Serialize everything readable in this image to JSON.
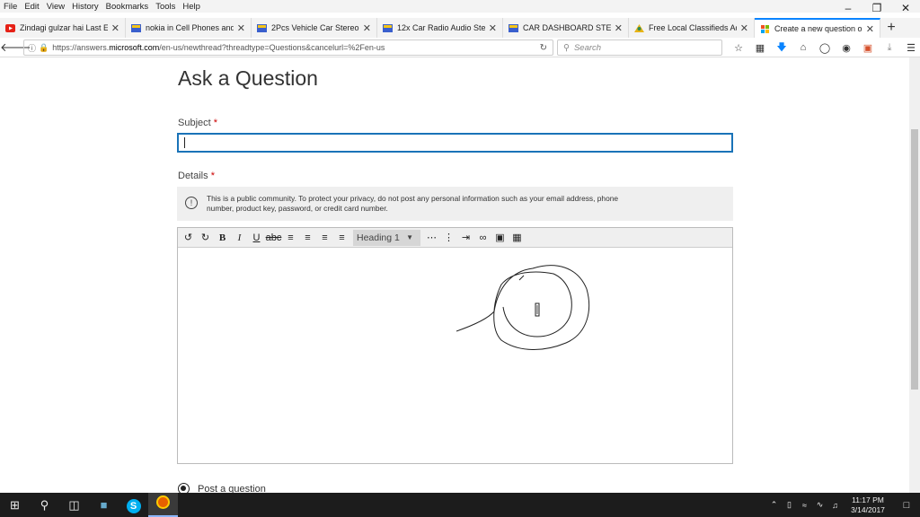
{
  "menu": [
    "File",
    "Edit",
    "View",
    "History",
    "Bookmarks",
    "Tools",
    "Help"
  ],
  "tabs": [
    {
      "title": "Zindagi gulzar hai Last Ep...",
      "favicon_color": "#e62117"
    },
    {
      "title": "nokia in Cell Phones and S...",
      "favicon_color": "#3a5fcd"
    },
    {
      "title": "2Pcs Vehicle Car Stereo R...",
      "favicon_color": "#3a5fcd"
    },
    {
      "title": "12x Car Radio Audio Stere...",
      "favicon_color": "#3a5fcd"
    },
    {
      "title": "CAR DASHBOARD STERE...",
      "favicon_color": "#3a5fcd"
    },
    {
      "title": "Free Local Classifieds Ads ...",
      "favicon_color": "#e7b416"
    },
    {
      "title": "Create a new question or ...",
      "favicon_color": "#f25022"
    }
  ],
  "url": {
    "prefix": "https://answers.",
    "domain": "microsoft.com",
    "path": "/en-us/newthread?threadtype=Questions&cancelurl=%2Fen-us"
  },
  "search_placeholder": "Search",
  "page": {
    "title": "Ask a Question",
    "subject_label": "Subject",
    "required_mark": "*",
    "details_label": "Details",
    "notice": "This is a public community. To protect your privacy, do not post any personal information such as your email address, phone number, product key, password, or credit card number.",
    "heading_select": "Heading 1",
    "post_option": "Post a question"
  },
  "clock": {
    "time": "11:17 PM",
    "date": "3/14/2017"
  }
}
